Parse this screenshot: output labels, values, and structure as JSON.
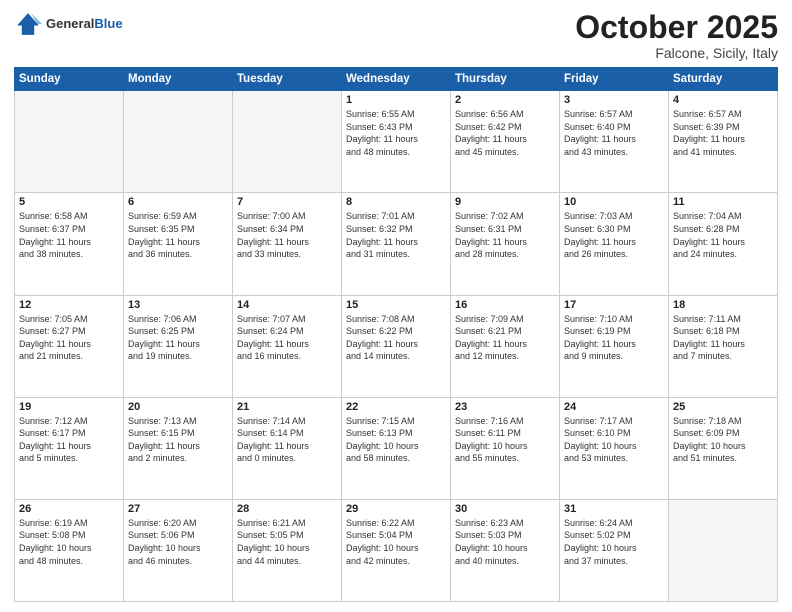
{
  "header": {
    "logo_general": "General",
    "logo_blue": "Blue",
    "month": "October 2025",
    "location": "Falcone, Sicily, Italy"
  },
  "days_of_week": [
    "Sunday",
    "Monday",
    "Tuesday",
    "Wednesday",
    "Thursday",
    "Friday",
    "Saturday"
  ],
  "weeks": [
    [
      {
        "day": "",
        "info": ""
      },
      {
        "day": "",
        "info": ""
      },
      {
        "day": "",
        "info": ""
      },
      {
        "day": "1",
        "info": "Sunrise: 6:55 AM\nSunset: 6:43 PM\nDaylight: 11 hours\nand 48 minutes."
      },
      {
        "day": "2",
        "info": "Sunrise: 6:56 AM\nSunset: 6:42 PM\nDaylight: 11 hours\nand 45 minutes."
      },
      {
        "day": "3",
        "info": "Sunrise: 6:57 AM\nSunset: 6:40 PM\nDaylight: 11 hours\nand 43 minutes."
      },
      {
        "day": "4",
        "info": "Sunrise: 6:57 AM\nSunset: 6:39 PM\nDaylight: 11 hours\nand 41 minutes."
      }
    ],
    [
      {
        "day": "5",
        "info": "Sunrise: 6:58 AM\nSunset: 6:37 PM\nDaylight: 11 hours\nand 38 minutes."
      },
      {
        "day": "6",
        "info": "Sunrise: 6:59 AM\nSunset: 6:35 PM\nDaylight: 11 hours\nand 36 minutes."
      },
      {
        "day": "7",
        "info": "Sunrise: 7:00 AM\nSunset: 6:34 PM\nDaylight: 11 hours\nand 33 minutes."
      },
      {
        "day": "8",
        "info": "Sunrise: 7:01 AM\nSunset: 6:32 PM\nDaylight: 11 hours\nand 31 minutes."
      },
      {
        "day": "9",
        "info": "Sunrise: 7:02 AM\nSunset: 6:31 PM\nDaylight: 11 hours\nand 28 minutes."
      },
      {
        "day": "10",
        "info": "Sunrise: 7:03 AM\nSunset: 6:30 PM\nDaylight: 11 hours\nand 26 minutes."
      },
      {
        "day": "11",
        "info": "Sunrise: 7:04 AM\nSunset: 6:28 PM\nDaylight: 11 hours\nand 24 minutes."
      }
    ],
    [
      {
        "day": "12",
        "info": "Sunrise: 7:05 AM\nSunset: 6:27 PM\nDaylight: 11 hours\nand 21 minutes."
      },
      {
        "day": "13",
        "info": "Sunrise: 7:06 AM\nSunset: 6:25 PM\nDaylight: 11 hours\nand 19 minutes."
      },
      {
        "day": "14",
        "info": "Sunrise: 7:07 AM\nSunset: 6:24 PM\nDaylight: 11 hours\nand 16 minutes."
      },
      {
        "day": "15",
        "info": "Sunrise: 7:08 AM\nSunset: 6:22 PM\nDaylight: 11 hours\nand 14 minutes."
      },
      {
        "day": "16",
        "info": "Sunrise: 7:09 AM\nSunset: 6:21 PM\nDaylight: 11 hours\nand 12 minutes."
      },
      {
        "day": "17",
        "info": "Sunrise: 7:10 AM\nSunset: 6:19 PM\nDaylight: 11 hours\nand 9 minutes."
      },
      {
        "day": "18",
        "info": "Sunrise: 7:11 AM\nSunset: 6:18 PM\nDaylight: 11 hours\nand 7 minutes."
      }
    ],
    [
      {
        "day": "19",
        "info": "Sunrise: 7:12 AM\nSunset: 6:17 PM\nDaylight: 11 hours\nand 5 minutes."
      },
      {
        "day": "20",
        "info": "Sunrise: 7:13 AM\nSunset: 6:15 PM\nDaylight: 11 hours\nand 2 minutes."
      },
      {
        "day": "21",
        "info": "Sunrise: 7:14 AM\nSunset: 6:14 PM\nDaylight: 11 hours\nand 0 minutes."
      },
      {
        "day": "22",
        "info": "Sunrise: 7:15 AM\nSunset: 6:13 PM\nDaylight: 10 hours\nand 58 minutes."
      },
      {
        "day": "23",
        "info": "Sunrise: 7:16 AM\nSunset: 6:11 PM\nDaylight: 10 hours\nand 55 minutes."
      },
      {
        "day": "24",
        "info": "Sunrise: 7:17 AM\nSunset: 6:10 PM\nDaylight: 10 hours\nand 53 minutes."
      },
      {
        "day": "25",
        "info": "Sunrise: 7:18 AM\nSunset: 6:09 PM\nDaylight: 10 hours\nand 51 minutes."
      }
    ],
    [
      {
        "day": "26",
        "info": "Sunrise: 6:19 AM\nSunset: 5:08 PM\nDaylight: 10 hours\nand 48 minutes."
      },
      {
        "day": "27",
        "info": "Sunrise: 6:20 AM\nSunset: 5:06 PM\nDaylight: 10 hours\nand 46 minutes."
      },
      {
        "day": "28",
        "info": "Sunrise: 6:21 AM\nSunset: 5:05 PM\nDaylight: 10 hours\nand 44 minutes."
      },
      {
        "day": "29",
        "info": "Sunrise: 6:22 AM\nSunset: 5:04 PM\nDaylight: 10 hours\nand 42 minutes."
      },
      {
        "day": "30",
        "info": "Sunrise: 6:23 AM\nSunset: 5:03 PM\nDaylight: 10 hours\nand 40 minutes."
      },
      {
        "day": "31",
        "info": "Sunrise: 6:24 AM\nSunset: 5:02 PM\nDaylight: 10 hours\nand 37 minutes."
      },
      {
        "day": "",
        "info": ""
      }
    ]
  ]
}
